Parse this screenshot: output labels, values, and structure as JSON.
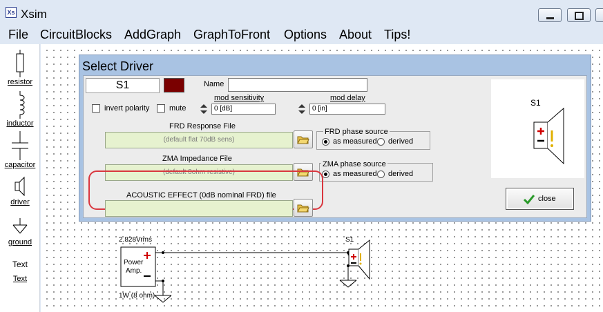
{
  "app": {
    "title": "Xsim",
    "icon_text": "Xs"
  },
  "menu": [
    "File",
    "CircuitBlocks",
    "AddGraph",
    "GraphToFront",
    "Options",
    "About",
    "Tips!"
  ],
  "toolbox": [
    {
      "label": "resistor",
      "icon": "resistor-icon"
    },
    {
      "label": "inductor",
      "icon": "inductor-icon"
    },
    {
      "label": "capacitor",
      "icon": "capacitor-icon"
    },
    {
      "label": "driver",
      "icon": "driver-icon"
    },
    {
      "label": "ground",
      "icon": "ground-icon"
    },
    {
      "label": "Text",
      "icon": "text-icon",
      "icon_text": "Text"
    }
  ],
  "dialog": {
    "title": "Select Driver",
    "driver_id": "S1",
    "color": "#7a0000",
    "name_label": "Name",
    "name_value": "",
    "invert_polarity_label": "invert polarity",
    "mute_label": "mute",
    "mod_sensitivity_label": "mod sensitivity",
    "mod_sensitivity_value": "0 [dB]",
    "mod_delay_label": "mod delay",
    "mod_delay_value": "0 [in]",
    "frd_label": "FRD Response File",
    "frd_value": "(default flat 70dB sens)",
    "frd_phase_label": "FRD phase source",
    "zma_label": "ZMA Impedance File",
    "zma_value": "(default 8ohm resistive)",
    "zma_phase_label": "ZMA phase source",
    "phase_as_measured": "as measured",
    "phase_derived": "derived",
    "acoustic_label": "ACOUSTIC EFFECT (0dB nominal FRD) file",
    "acoustic_value": "",
    "preview_label": "S1",
    "close_label": "close"
  },
  "circuit": {
    "source_voltage": "2.828Vrms",
    "source_name_1": "Power",
    "source_name_2": "Amp.",
    "source_rating": "1W (8 ohm)",
    "driver_label": "S1"
  }
}
